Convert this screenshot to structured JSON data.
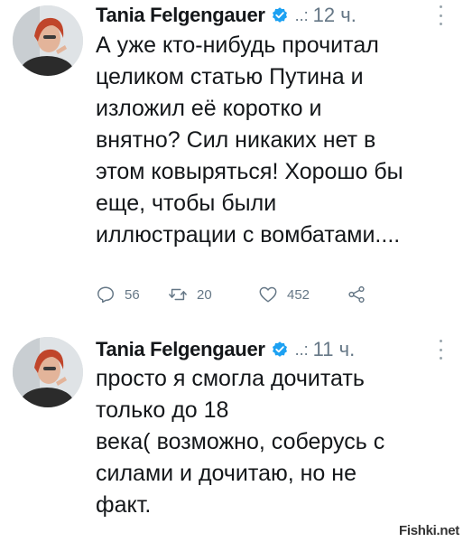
{
  "tweets": [
    {
      "author": "Tania Felgengauer",
      "dots": "..:",
      "time": "12 ч.",
      "text": "А уже кто-нибудь прочитал\nцеликом статью Путина и\nизложил её коротко и\nвнятно? Сил никаких нет в\nэтом ковыряться! Хорошо бы\nеще, чтобы были\nиллюстрации с вомбатами....",
      "replies": "56",
      "retweets": "20",
      "likes": "452"
    },
    {
      "author": "Tania Felgengauer",
      "dots": "..:",
      "time": "11 ч.",
      "text": "просто я смогла дочитать\nтолько до 18\nвека( возможно, соберусь с\nсилами и дочитаю, но не\nфакт."
    }
  ],
  "icons": {
    "verified": "verified-badge-icon",
    "reply": "reply-icon",
    "retweet": "retweet-icon",
    "like": "heart-icon",
    "share": "share-icon",
    "more": "more-vertical-icon"
  },
  "colors": {
    "verified": "#1da1f2",
    "muted": "#657786",
    "text": "#14171a"
  },
  "watermark": "Fishki.net"
}
